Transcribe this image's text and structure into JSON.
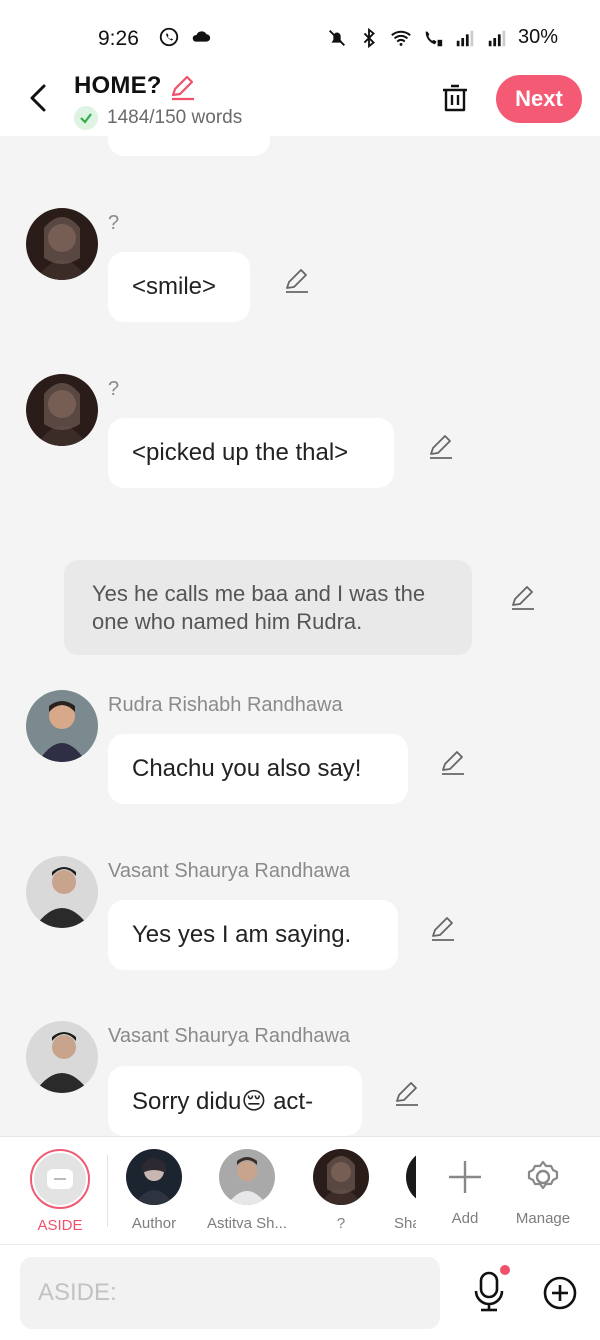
{
  "status": {
    "time": "9:26",
    "battery": "30%"
  },
  "header": {
    "title": "HOME?",
    "word_count": "1484/150 words",
    "next_label": "Next",
    "accent": "#f55a74"
  },
  "messages": [
    {
      "speaker": "?",
      "text": "<smile>",
      "avatar": "veiled-woman-avatar"
    },
    {
      "speaker": "?",
      "text": "<picked up the thal>",
      "avatar": "veiled-woman-avatar"
    },
    {
      "aside": "Yes he calls me baa and I was the one who named him Rudra."
    },
    {
      "speaker": "Rudra Rishabh Randhawa",
      "text": "Chachu you also say!",
      "avatar": "child-avatar"
    },
    {
      "speaker": "Vasant Shaurya Randhawa",
      "text": "Yes yes I am saying.",
      "avatar": "man-avatar"
    },
    {
      "speaker": "Vasant Shaurya Randhawa",
      "text": "Sorry didu😔 act-",
      "avatar": "man-avatar"
    }
  ],
  "characters": [
    {
      "label": "ASIDE",
      "active": true
    },
    {
      "label": "Author"
    },
    {
      "label": "Astitva Sh..."
    },
    {
      "label": "?"
    },
    {
      "label": "Sha"
    },
    {
      "label": "Add"
    },
    {
      "label": "Manage"
    }
  ],
  "input": {
    "placeholder": "ASIDE:"
  }
}
